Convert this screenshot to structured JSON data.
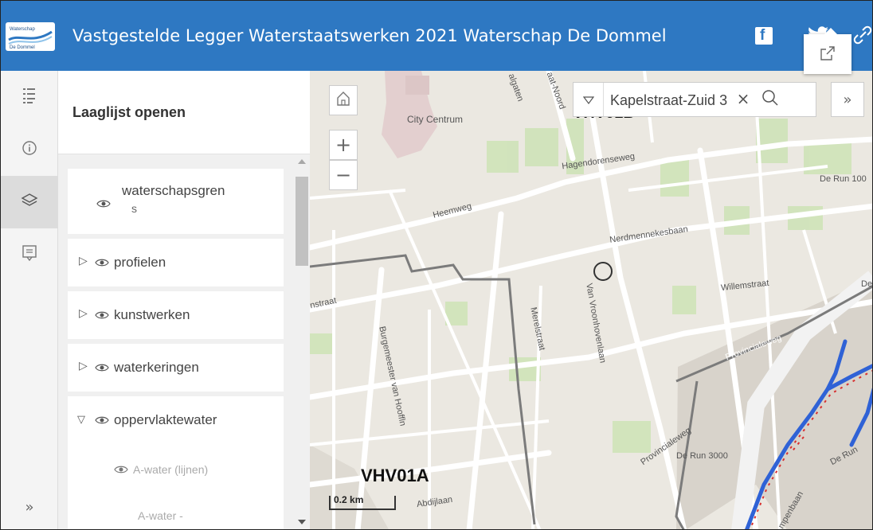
{
  "header": {
    "title": "Vastgestelde Legger Waterstaatswerken 2021 Waterschap De Dommel",
    "logo_text": "Waterschap De Dommel",
    "share_icons": [
      "facebook-icon",
      "twitter-icon",
      "link-icon"
    ],
    "background": "#2e78c2"
  },
  "rail": {
    "buttons": [
      "legend-icon",
      "info-icon",
      "layers-icon",
      "bookmark-icon"
    ],
    "active": "layers-icon",
    "expand_label": "»"
  },
  "panel": {
    "title": "Laaglijst openen",
    "layers": [
      {
        "label_line1": "waterschapsgren",
        "label_line2": "s",
        "expandable": false
      },
      {
        "label": "profielen",
        "expandable": true,
        "expanded": false
      },
      {
        "label": "kunstwerken",
        "expandable": true,
        "expanded": false
      },
      {
        "label": "waterkeringen",
        "expandable": true,
        "expanded": false
      },
      {
        "label": "oppervlaktewater",
        "expandable": true,
        "expanded": true
      }
    ],
    "sublayers": [
      "A-water (lijnen)",
      "A-water -"
    ]
  },
  "map": {
    "search": {
      "value": "Kapelstraat-Zuid 3",
      "clear": "×",
      "more": "»"
    },
    "zoom_in": "+",
    "zoom_out": "−",
    "scale_label": "0.2 km",
    "labels": {
      "city_centrum": "City Centrum",
      "hagendorenseweg": "Hagendorenseweg",
      "heemweg": "Heemweg",
      "nerdmennekesbaan": "Nerdmennekesbaan",
      "willemstraat": "Willemstraat",
      "provincialeweg_1": "Provincialeweg",
      "provincialeweg_2": "Provincialeweg",
      "burgemeester": "Burgemeester van Hooffln",
      "van_vroonhovenlaan": "Van Vroonhovenlaan",
      "merelstraat": "Merelstraat",
      "de_run_1000": "De Run 100",
      "de_run_3000": "De Run 3000",
      "de_run": "De Run",
      "abdijlaan": "Abdijlaan",
      "instraat": "nstraat",
      "algaten": "algaten",
      "aat_noord": "aat-Noord",
      "mpenbaan": "mpenbaan",
      "de": "De"
    },
    "vhv01b": "VHV01B",
    "vhv01a": "VHV01A"
  }
}
